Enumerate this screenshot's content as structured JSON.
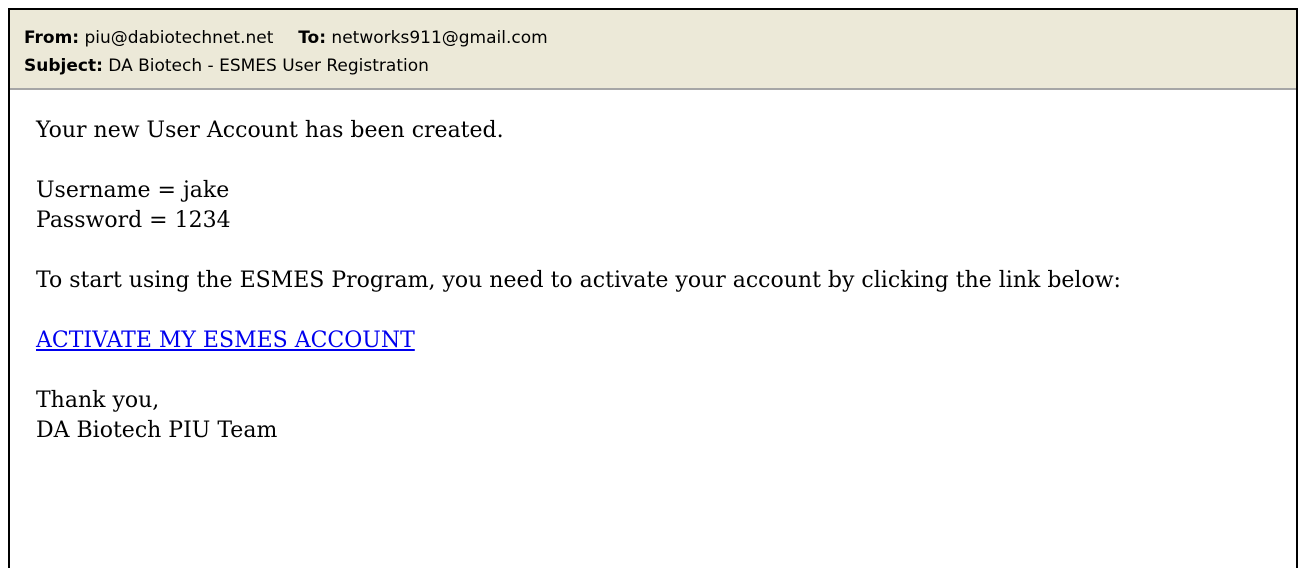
{
  "email": {
    "header": {
      "from_label": "From:",
      "from_value": "piu@dabiotechnet.net",
      "to_label": "To:",
      "to_value": "networks911@gmail.com",
      "subject_label": "Subject:",
      "subject_value": "DA Biotech - ESMES User Registration"
    },
    "body": {
      "intro": "Your new User Account has been created.",
      "username_line": "Username = jake",
      "password_line": "Password = 1234",
      "instruction": "To start using the ESMES Program, you need to activate your account by clicking the link below:",
      "activate_link": "ACTIVATE MY ESMES ACCOUNT",
      "closing": "Thank you,",
      "signature": "DA Biotech PIU Team"
    },
    "colors": {
      "header_bg": "#ece9d8",
      "link": "#0000ee"
    }
  }
}
